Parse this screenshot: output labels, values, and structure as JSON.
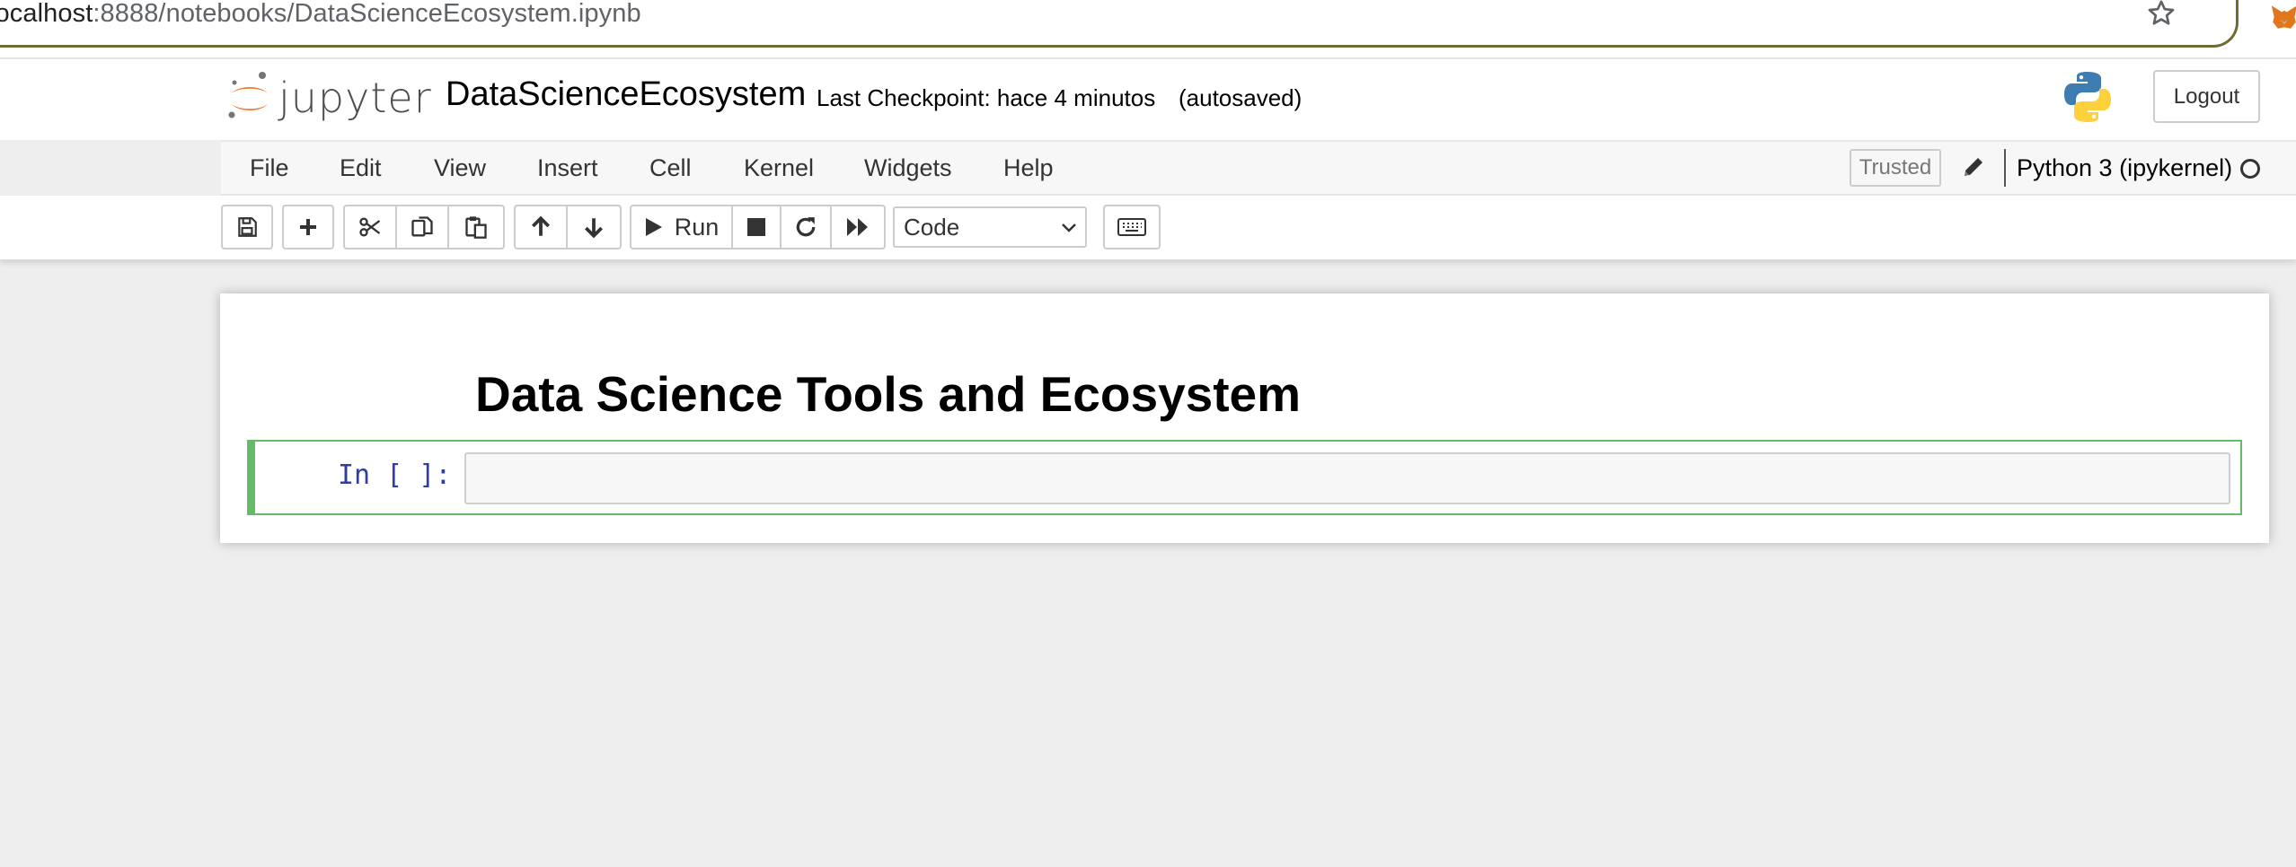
{
  "browser": {
    "url_host": "localhost",
    "url_rest": ":8888/notebooks/DataScienceEcosystem.ipynb"
  },
  "header": {
    "logo_text": "jupyter",
    "notebook_name": "DataScienceEcosystem",
    "checkpoint": "Last Checkpoint: hace 4 minutos",
    "autosaved": "(autosaved)",
    "logout_label": "Logout"
  },
  "menubar": {
    "items": [
      {
        "label": "File"
      },
      {
        "label": "Edit"
      },
      {
        "label": "View"
      },
      {
        "label": "Insert"
      },
      {
        "label": "Cell"
      },
      {
        "label": "Kernel"
      },
      {
        "label": "Widgets"
      },
      {
        "label": "Help"
      }
    ],
    "trusted_label": "Trusted",
    "kernel_name": "Python 3 (ipykernel)"
  },
  "toolbar": {
    "run_label": "Run",
    "cell_type": "Code",
    "icons": [
      "save-icon",
      "plus-icon",
      "cut-icon",
      "copy-icon",
      "paste-icon",
      "arrow-up-icon",
      "arrow-down-icon",
      "play-icon",
      "stop-icon",
      "restart-icon",
      "fast-forward-icon",
      "keyboard-icon"
    ]
  },
  "notebook": {
    "markdown_title": "Data Science Tools and Ecosystem",
    "code_prompt": "In [ ]:"
  },
  "colors": {
    "selected_cell_border": "#66bb6a",
    "prompt_color": "#303f9f",
    "jupyter_orange": "#f37726"
  }
}
